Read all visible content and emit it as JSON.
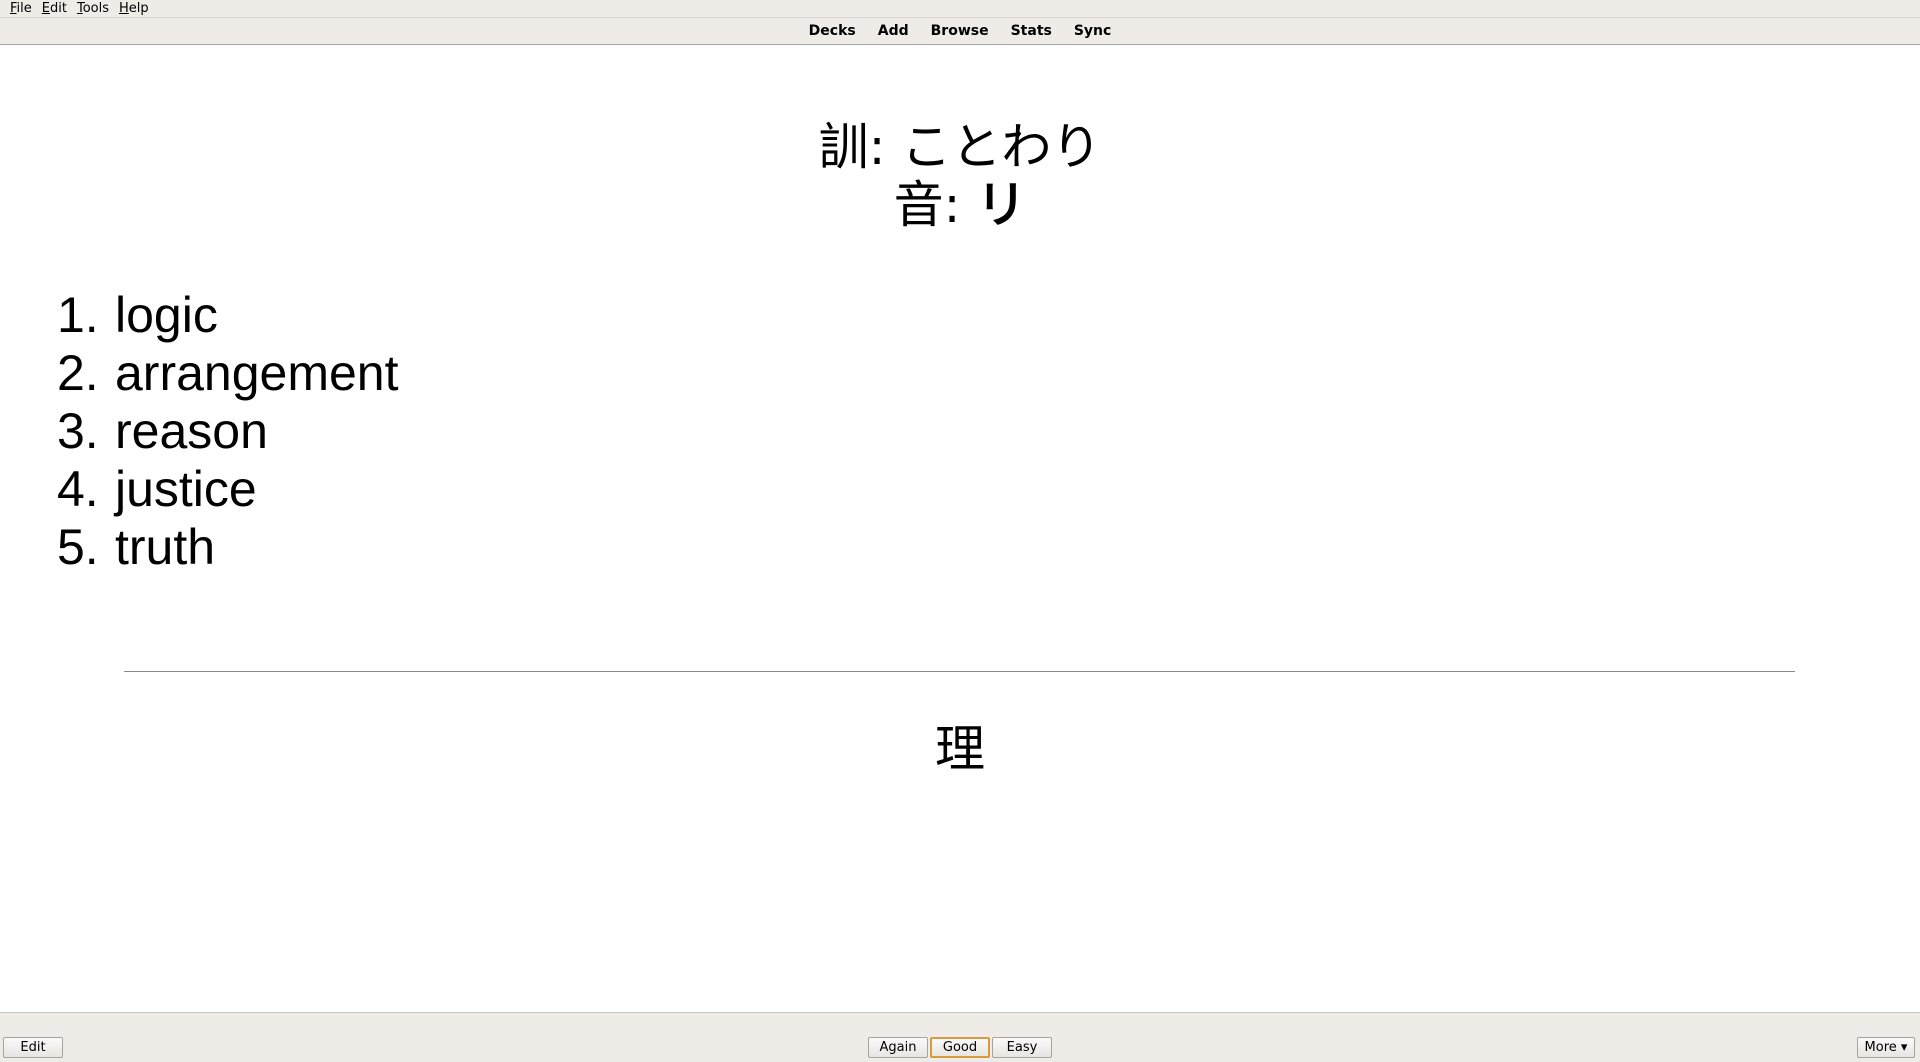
{
  "menu": {
    "items": [
      {
        "mnemonic": "F",
        "rest": "ile"
      },
      {
        "mnemonic": "E",
        "rest": "dit"
      },
      {
        "mnemonic": "T",
        "rest": "ools"
      },
      {
        "mnemonic": "H",
        "rest": "elp"
      }
    ]
  },
  "toolbar": {
    "links": [
      "Decks",
      "Add",
      "Browse",
      "Stats",
      "Sync"
    ]
  },
  "card": {
    "kun_label": "訓: ",
    "kun_value": "ことわり",
    "on_label": "音: ",
    "on_value": "リ",
    "meanings": [
      {
        "num": "1.",
        "text": "logic"
      },
      {
        "num": "2.",
        "text": "arrangement"
      },
      {
        "num": "3.",
        "text": "reason"
      },
      {
        "num": "4.",
        "text": "justice"
      },
      {
        "num": "5.",
        "text": "truth"
      }
    ],
    "kanji": "理"
  },
  "bottom": {
    "edit_label": "Edit",
    "again_label": "Again",
    "good_label": "Good",
    "easy_label": "Easy",
    "more_label": "More ▾"
  }
}
